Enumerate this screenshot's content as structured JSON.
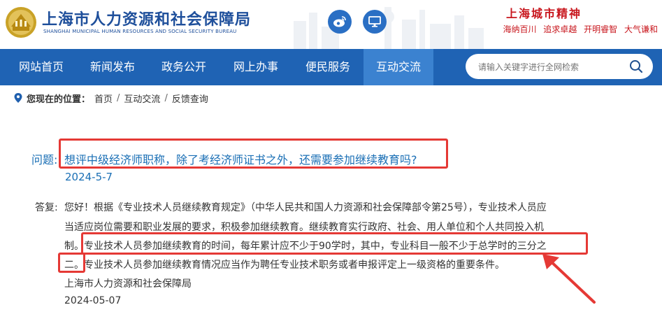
{
  "header": {
    "site_name_cn": "上海市人力资源和社会保障局",
    "site_name_en": "SHANGHAI MUNICIPAL HUMAN RESOURCES AND SOCIAL SECURITY BUREAU",
    "slogan_title": "上海城市精神",
    "slogans": [
      "海纳百川",
      "追求卓越",
      "开明睿智",
      "大气谦和"
    ],
    "icons": [
      "weibo-icon",
      "monitor-icon"
    ]
  },
  "nav": {
    "items": [
      "网站首页",
      "新闻发布",
      "政务公开",
      "网上办事",
      "便民服务",
      "互动交流"
    ],
    "active_index": 5
  },
  "search": {
    "placeholder": "请输入关键字进行全网检索"
  },
  "breadcrumb": {
    "label": "您现在的位置：",
    "items": [
      "首页",
      "互动交流",
      "反馈查询"
    ]
  },
  "question": {
    "label": "问题:",
    "text": "想评中级经济师职称，除了考经济师证书之外，还需要参加继续教育吗?",
    "date": "2024-5-7"
  },
  "answer": {
    "label": "答复:",
    "lines": [
      "您好！根据《专业技术人员继续教育规定》（中华人民共和国人力资源和社会保障部令第25号），专业技术人员应",
      "当适应岗位需要和职业发展的要求，积极参加继续教育。继续教育实行政府、社会、用人单位和个人共同投入机",
      "制。专业技术人员参加继续教育的时间，每年累计应不少于90学时，其中，专业科目一般不少于总学时的三分之",
      "二。专业技术人员参加继续教育情况应当作为聘任专业技术职务或者申报评定上一级资格的重要条件。"
    ],
    "org": "上海市人力资源和社会保障局",
    "date": "2024-05-07"
  },
  "colors": {
    "nav_bg": "#1f63b4",
    "nav_active": "#3b82d0",
    "brand_blue": "#1e4f9b",
    "question_blue": "#1a6fb5",
    "highlight_red": "#e53935",
    "slogan_red": "#c8161d"
  }
}
